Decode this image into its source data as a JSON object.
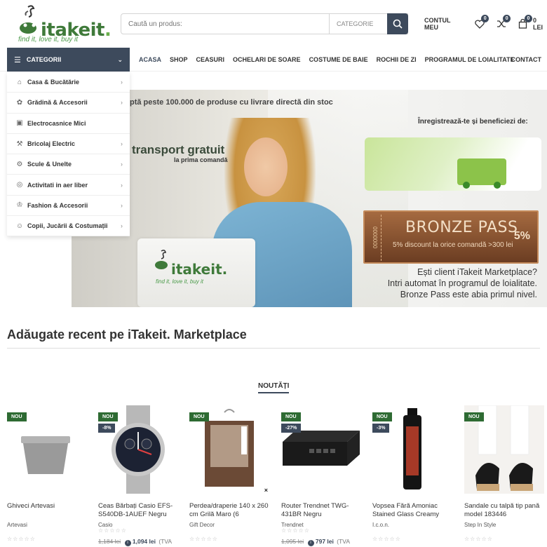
{
  "brand": {
    "name": "itakeit",
    "tagline": "find it, love it, buy it"
  },
  "search": {
    "placeholder": "Caută un produs:",
    "category": "CATEGORIE"
  },
  "header": {
    "account": "CONTUL MEU",
    "wishlist_count": "0",
    "compare_count": "0",
    "cart_count": "0",
    "cart_total": "0 LEI"
  },
  "nav": {
    "categories_label": "CATEGORII",
    "links": [
      "ACASA",
      "SHOP",
      "CEASURI",
      "OCHELARI DE SOARE",
      "COSTUME DE BAIE",
      "ROCHII DE ZI",
      "PROGRAMUL DE LOIALITATE"
    ],
    "contact": "CONTACT"
  },
  "categories": [
    {
      "label": "Casa & Bucătărie",
      "icon": "house-icon",
      "has_sub": true
    },
    {
      "label": "Grădină & Accesorii",
      "icon": "garden-icon",
      "has_sub": true
    },
    {
      "label": "Electrocasnice Mici",
      "icon": "appliance-icon",
      "has_sub": false
    },
    {
      "label": "Bricolaj Electric",
      "icon": "drill-icon",
      "has_sub": true
    },
    {
      "label": "Scule & Unelte",
      "icon": "tools-icon",
      "has_sub": true
    },
    {
      "label": "Activitati in aer liber",
      "icon": "outdoor-icon",
      "has_sub": true
    },
    {
      "label": "Fashion & Accesorii",
      "icon": "fashion-icon",
      "has_sub": true
    },
    {
      "label": "Copii, Jucării & Costumații",
      "icon": "kids-icon",
      "has_sub": true
    }
  ],
  "banner": {
    "top_text": "ptă peste 100.000 de produse cu livrare directă din stoc",
    "register_text": "Înregistrează-te și beneficiezi de:",
    "transport_title": "transport gratuit",
    "transport_sub": "la prima comandă",
    "bronze_title": "BRONZE PASS",
    "bronze_sub": "5% discount la orice comandă >300 lei",
    "bronze_pct": "5%",
    "bronze_code": "0000000",
    "loyalty_lines": [
      "Ești client iTakeit Marketplace?",
      "Intri automat în programul de loialitate.",
      "Bronze Pass este abia primul nivel."
    ]
  },
  "section": {
    "title": "Adăugate recent pe iTakeit. Marketplace",
    "tab": "NOUTĂȚI"
  },
  "products": [
    {
      "name": "Ghiveci Artevasi",
      "brand": "Artevasi",
      "badge": "NOU",
      "discount": "",
      "old_price": "",
      "price": "",
      "vat": ""
    },
    {
      "name": "Ceas Bărbați Casio EFS-S540DB-1AUEF Negru",
      "brand": "Casio",
      "badge": "NOU",
      "discount": "-8%",
      "old_price": "1,184 lei",
      "price": "1,094 lei",
      "vat": "(TVA"
    },
    {
      "name": "Perdea/draperie 140 x 260 cm Grilă Maro (6",
      "brand": "Gift Decor",
      "badge": "NOU",
      "discount": "",
      "old_price": "",
      "price": "",
      "vat": ""
    },
    {
      "name": "Router Trendnet TWG-431BR Negru",
      "brand": "Trendnet",
      "badge": "NOU",
      "discount": "-27%",
      "old_price": "1,095 lei",
      "price": "797 lei",
      "vat": "(TVA"
    },
    {
      "name": "Vopsea Fără Amoniac Stained Glass Creamy",
      "brand": "I.c.o.n.",
      "badge": "NOU",
      "discount": "-3%",
      "old_price": "",
      "price": "",
      "vat": ""
    },
    {
      "name": "Sandale cu talpă tip pană model 183446",
      "brand": "Step In Style",
      "badge": "NOU",
      "discount": "",
      "old_price": "",
      "price": "",
      "vat": ""
    }
  ]
}
